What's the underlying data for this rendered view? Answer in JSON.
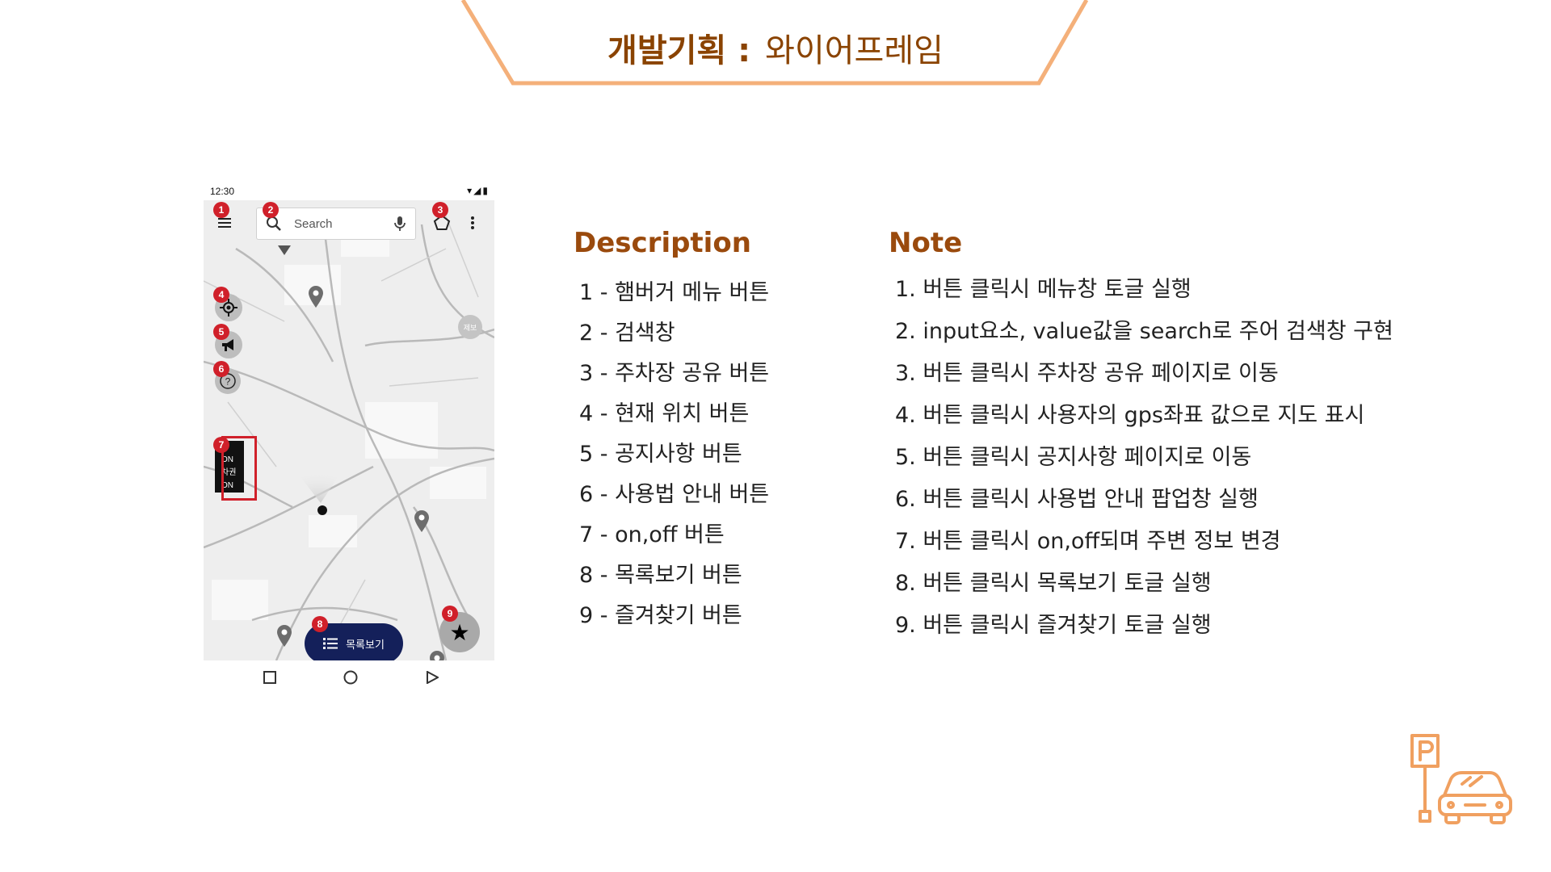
{
  "header": {
    "title_bold": "개발기획 :",
    "title_light": "와이어프레임",
    "accent_color": "#f4b07a"
  },
  "phone": {
    "status_time": "12:30",
    "search_placeholder": "Search",
    "list_button_label": "목록보기",
    "toggle_panel": [
      "유",
      "ON",
      "차권",
      "ON"
    ],
    "small_circle_text": "제보",
    "badges": [
      "1",
      "2",
      "3",
      "4",
      "5",
      "6",
      "7",
      "8",
      "9"
    ]
  },
  "description": {
    "heading": "Description",
    "items": [
      "1 - 햄버거 메뉴 버튼",
      "2 - 검색창",
      "3 - 주차장 공유 버튼",
      "4 - 현재 위치 버튼",
      "5 - 공지사항 버튼",
      "6 - 사용법 안내 버튼",
      "7 - on,off 버튼",
      "8 - 목록보기 버튼",
      "9 - 즐겨찾기 버튼"
    ]
  },
  "note": {
    "heading": "Note",
    "items": [
      "1. 버튼 클릭시 메뉴창 토글 실행",
      "2. input요소, value값을 search로 주어 검색창 구현",
      "3. 버튼 클릭시 주차장 공유 페이지로 이동",
      "4. 버튼 클릭시 사용자의 gps좌표 값으로 지도 표시",
      "5. 버튼 클릭시 공지사항 페이지로 이동",
      "6. 버튼 클릭시 사용법 안내 팝업창 실행",
      "7. 버튼 클릭시 on,off되며 주변 정보 변경",
      "8. 버튼 클릭시 목록보기 토글 실행",
      "9. 버튼 클릭시 즐겨찾기 토글 실행"
    ]
  },
  "icons": [
    "hamburger-menu-icon",
    "search-icon",
    "mic-icon",
    "pentagon-icon",
    "more-vert-icon",
    "location-target-icon",
    "megaphone-icon",
    "help-icon",
    "list-icon",
    "star-icon",
    "map-pin-icon",
    "parking-car-logo-icon"
  ]
}
